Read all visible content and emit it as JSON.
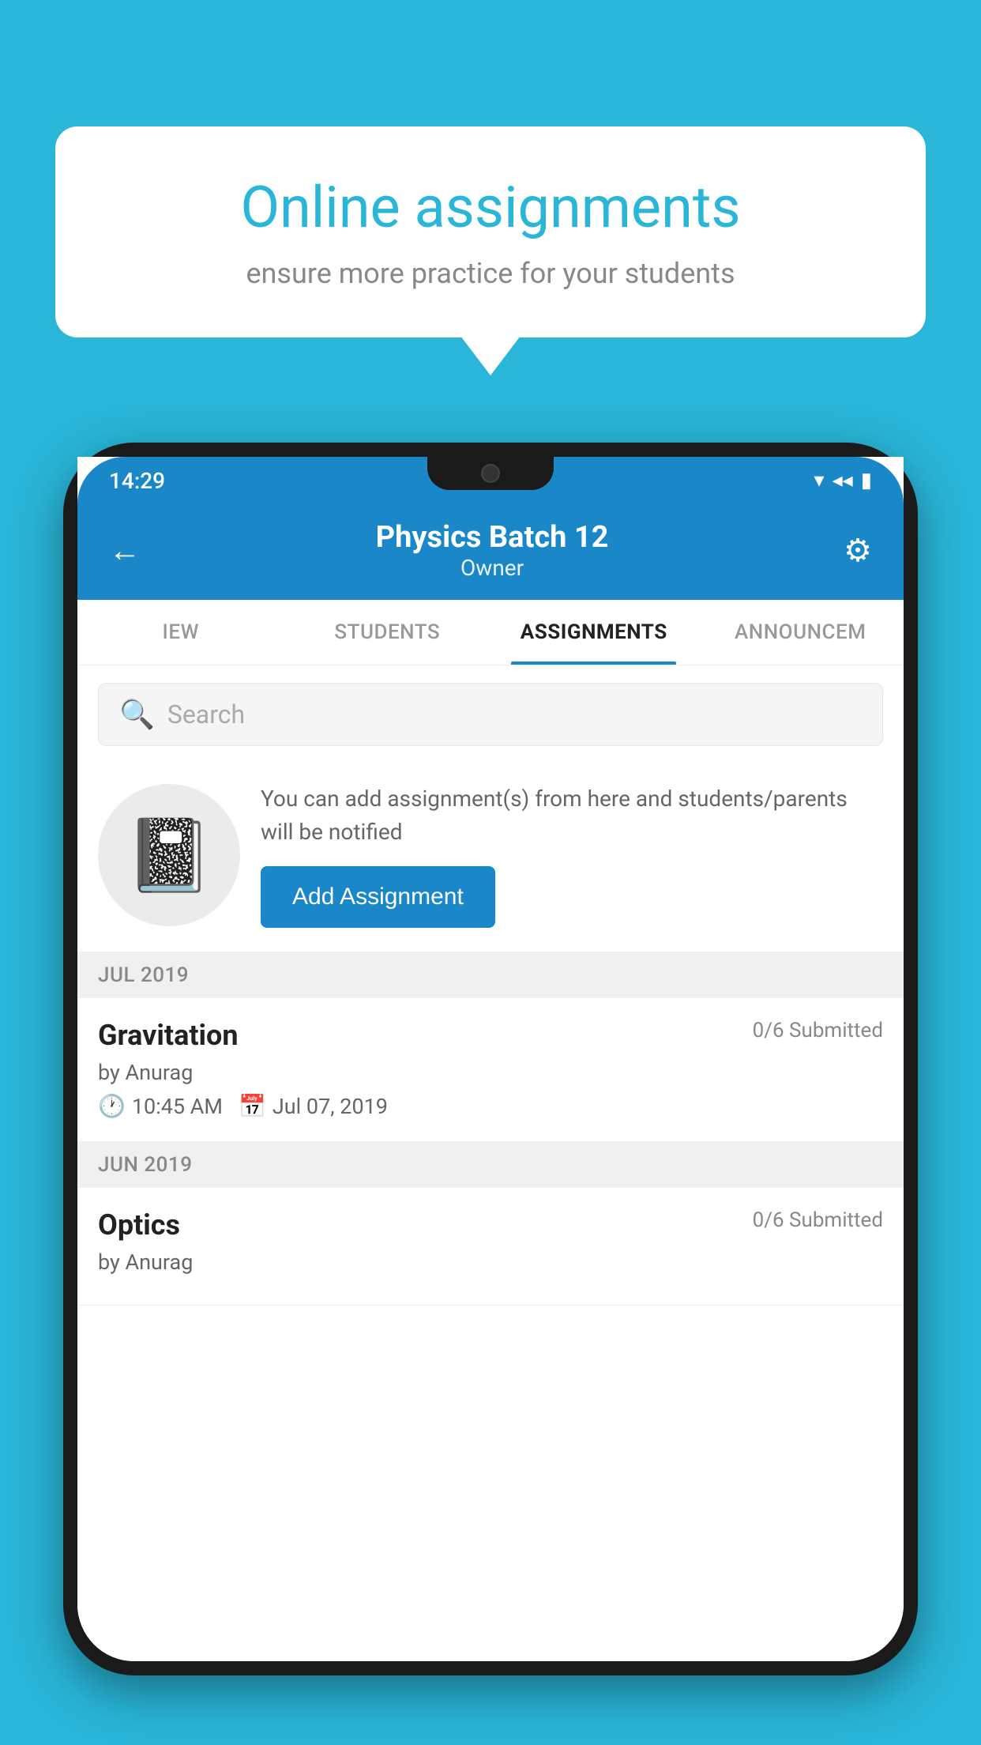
{
  "background_color": "#29b6d8",
  "speech_bubble": {
    "title": "Online assignments",
    "subtitle": "ensure more practice for your students"
  },
  "phone": {
    "status_bar": {
      "time": "14:29",
      "icons": [
        "wifi",
        "signal",
        "battery"
      ]
    },
    "header": {
      "title": "Physics Batch 12",
      "subtitle": "Owner",
      "back_label": "←",
      "settings_label": "⚙"
    },
    "tabs": [
      {
        "label": "IEW",
        "active": false
      },
      {
        "label": "STUDENTS",
        "active": false
      },
      {
        "label": "ASSIGNMENTS",
        "active": true
      },
      {
        "label": "ANNOUNCEM",
        "active": false
      }
    ],
    "search": {
      "placeholder": "Search"
    },
    "promo": {
      "text": "You can add assignment(s) from here and students/parents will be notified",
      "button_label": "Add Assignment"
    },
    "sections": [
      {
        "month": "JUL 2019",
        "assignments": [
          {
            "name": "Gravitation",
            "submitted": "0/6 Submitted",
            "author": "by Anurag",
            "time": "10:45 AM",
            "date": "Jul 07, 2019"
          }
        ]
      },
      {
        "month": "JUN 2019",
        "assignments": [
          {
            "name": "Optics",
            "submitted": "0/6 Submitted",
            "author": "by Anurag",
            "time": "",
            "date": ""
          }
        ]
      }
    ]
  }
}
